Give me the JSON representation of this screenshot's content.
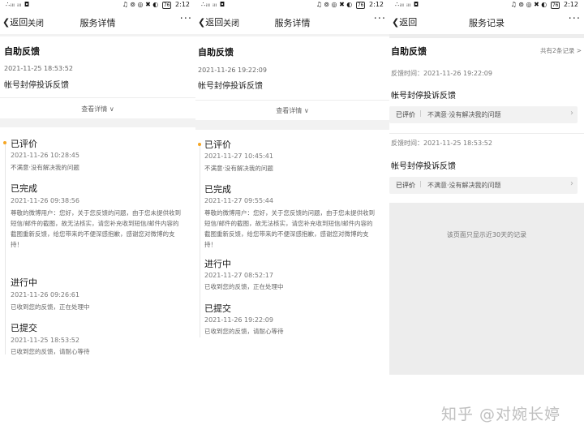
{
  "status_bar": {
    "left": "∴ᵢₗₗ ᵢₗₗ ◘",
    "right": "♫ ⊚ ◎ ✖ ◐",
    "battery": "76",
    "time": "2:12"
  },
  "panel1": {
    "nav": {
      "back": "返回",
      "close": "关闭",
      "title": "服务详情",
      "more": "···"
    },
    "header": {
      "title": "自助反馈",
      "time": "2021-11-25 18:53:52",
      "category": "帐号封停投诉反馈",
      "view_details": "查看详情 ∨"
    },
    "timeline": [
      {
        "title": "已评价",
        "time": "2021-11-26 10:28:45",
        "text": [
          "不满意·没有解决我的问题"
        ]
      },
      {
        "title": "已完成",
        "time": "2021-11-26 09:38:56",
        "text": [
          "尊敬的微博用户：您好，关于您反馈的问题，由于您未提供收到",
          "短信/邮件的截图，故无法核实，请您补充收到短信/邮件内容的",
          "截图重新反馈，给您带来的不便深感抱歉，感谢您对微博的支",
          "持！"
        ]
      },
      {
        "title": "进行中",
        "time": "2021-11-26 09:26:61",
        "text": [
          "已收到您的反馈，正在处理中"
        ]
      },
      {
        "title": "已提交",
        "time": "2021-11-25 18:53:52",
        "text": [
          "已收到您的反馈，请耐心等待"
        ]
      }
    ]
  },
  "panel2": {
    "nav": {
      "back": "返回",
      "close": "关闭",
      "title": "服务详情",
      "more": "···"
    },
    "header": {
      "title": "自助反馈",
      "time": "2021-11-26 19:22:09",
      "category": "帐号封停投诉反馈",
      "view_details": "查看详情 ∨"
    },
    "timeline": [
      {
        "title": "已评价",
        "time": "2021-11-27 10:45:41",
        "text": [
          "不满意·没有解决我的问题"
        ]
      },
      {
        "title": "已完成",
        "time": "2021-11-27 09:55:44",
        "text": [
          "尊敬的微博用户：您好，关于您反馈的问题，由于您未提供收到",
          "短信/邮件的截图，故无法核实，请您补充收到短信/邮件内容的",
          "截图重新反馈，给您带来的不便深感抱歉，感谢您对微博的支",
          "持！"
        ]
      },
      {
        "title": "进行中",
        "time": "2021-11-27 08:52:17",
        "text": [
          "已收到您的反馈，正在处理中"
        ]
      },
      {
        "title": "已提交",
        "time": "2021-11-26 19:22:09",
        "text": [
          "已收到您的反馈，请耐心等待"
        ]
      }
    ]
  },
  "panel3": {
    "nav": {
      "back": "返回",
      "title": "服务记录",
      "more": "···"
    },
    "header": {
      "title": "自助反馈",
      "count": "共有2条记录 >"
    },
    "records": [
      {
        "time_line": "反馈时间：2021-11-26 19:22:09",
        "category": "帐号封停投诉反馈",
        "status": "已评价",
        "sep": "|",
        "eval": "不满意·没有解决我的问题",
        "arrow": "›"
      },
      {
        "time_line": "反馈时间：2021-11-25 18:53:52",
        "category": "帐号封停投诉反馈",
        "status": "已评价",
        "sep": "|",
        "eval": "不满意·没有解决我的问题",
        "arrow": "›"
      }
    ],
    "notice": "该页面只显示近30天的记录"
  },
  "watermark": "知乎 @对婉长婷",
  "colors": {
    "accent_dot": "#f5a623",
    "page_bg": "#f2f2f2",
    "card_bg": "#ffffff"
  }
}
